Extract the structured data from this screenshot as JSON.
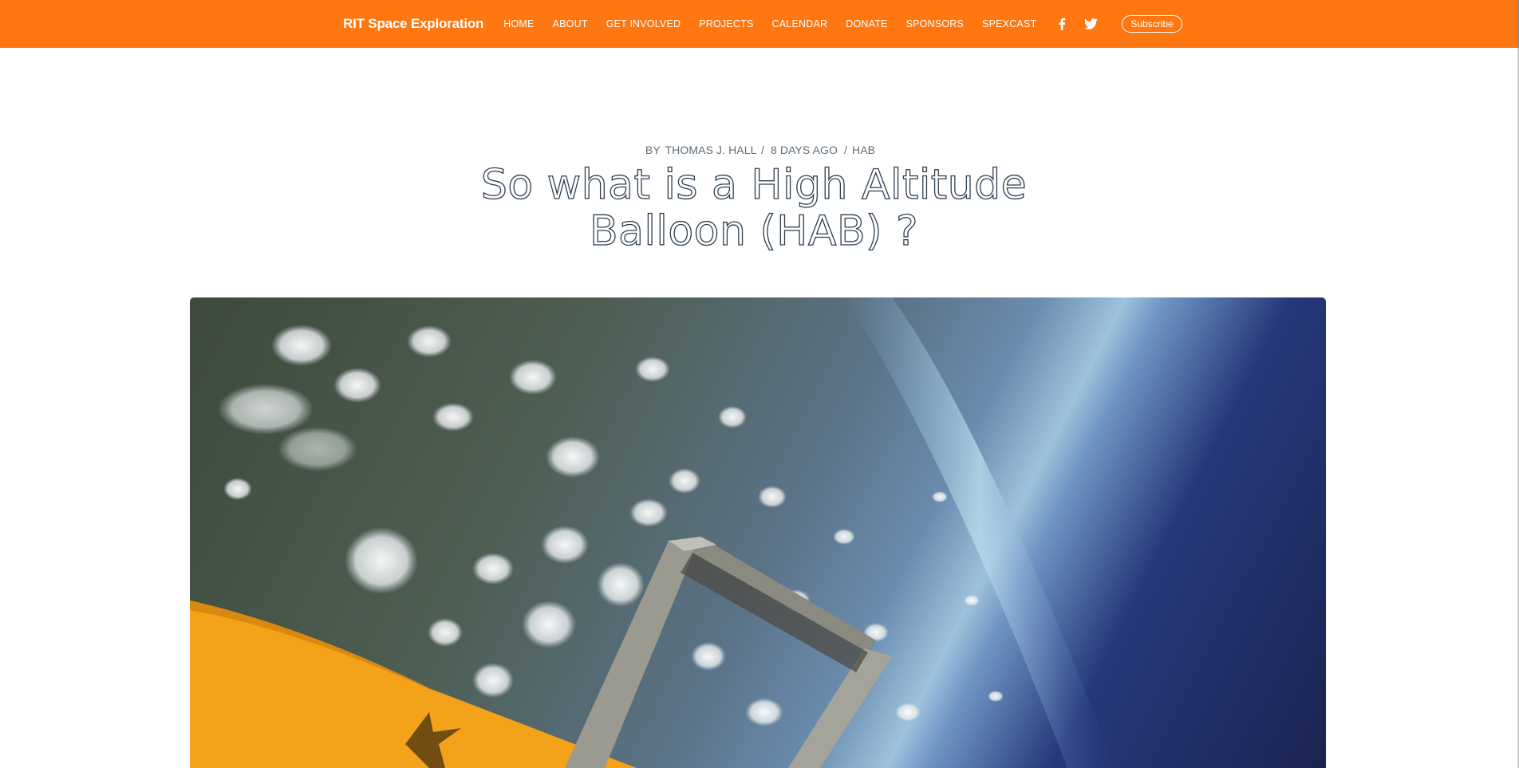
{
  "site": {
    "brand": "RIT Space Exploration"
  },
  "nav": {
    "items": [
      "HOME",
      "ABOUT",
      "GET INVOLVED",
      "PROJECTS",
      "CALENDAR",
      "DONATE",
      "SPONSORS",
      "SPEXCAST"
    ]
  },
  "social": {
    "facebook_icon": "facebook-icon",
    "twitter_icon": "twitter-icon",
    "subscribe_label": "Subscribe"
  },
  "post": {
    "by_label": "BY",
    "author": "THOMAS J. HALL",
    "separator": "/",
    "date": "8 DAYS AGO",
    "tag": "HAB",
    "title": "So what is a High Altitude Balloon (HAB) ?"
  },
  "colors": {
    "brand_orange": "#ff7710",
    "meta_text": "#5f6e7a"
  }
}
